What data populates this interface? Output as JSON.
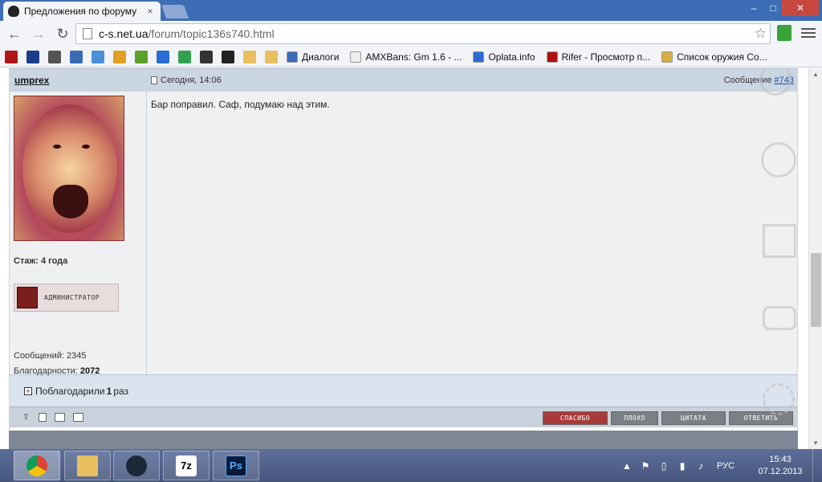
{
  "window": {
    "tab_title": "Предложения по форуму",
    "tab_close": "×",
    "min": "–",
    "max": "□",
    "close": "✕"
  },
  "toolbar": {
    "back": "←",
    "forward": "→",
    "reload": "↻",
    "url_host": "c-s.net.ua",
    "url_path": "/forum/topic136s740.html",
    "star": "☆"
  },
  "bookmarks": [
    {
      "label": "Диалоги",
      "color": "#3b6bb4"
    },
    {
      "label": "AMXBans: Gm 1.6 - ...",
      "color": "#eeeeee"
    },
    {
      "label": "Oplata.info",
      "color": "#2a6cd0"
    },
    {
      "label": "Rifer - Просмотр п...",
      "color": "#b01010"
    },
    {
      "label": "Список оружия Co...",
      "color": "#d8b040"
    }
  ],
  "bookmark_icon_colors": [
    "#b01818",
    "#1a3c8a",
    "#555555",
    "#3b6bb4",
    "#4a90d9",
    "#e0a020",
    "#5aa02a",
    "#2a6cd0",
    "#30a050",
    "#333333",
    "#222222",
    "#e8c060",
    "#e8c060"
  ],
  "post": {
    "author": "umprex",
    "date": "Сегодня, 14:06",
    "number_prefix": "Сообщение ",
    "number": "#743",
    "message": "Бар поправил. Саф, подумаю над этим.",
    "stage": "Стаж: 4 года",
    "role": "АДМИНИСТРАТОР",
    "messages_count": "Сообщений: 2345",
    "thanks_label": "Благодарности: ",
    "thanks_value": "2072",
    "thanked_prefix": "Поблагодарили ",
    "thanked_count": "1",
    "thanked_suffix": " раз",
    "btn_thanks": "СПАСИБО",
    "btn_bad": "ПЛОХО",
    "btn_quote": "ЦИТАТА",
    "btn_reply": "ОТВЕТИТЬ"
  },
  "taskbar": {
    "lang": "РУС",
    "time": "15:43",
    "date": "07.12.2013",
    "apps": [
      "chrome",
      "explorer",
      "steam",
      "7z",
      "Ps"
    ]
  },
  "colors": {
    "title_bar": "#3d6db5",
    "post_header": "#cad6e2",
    "thanks_button": "#a83a3a",
    "link": "#1c4fa0"
  }
}
